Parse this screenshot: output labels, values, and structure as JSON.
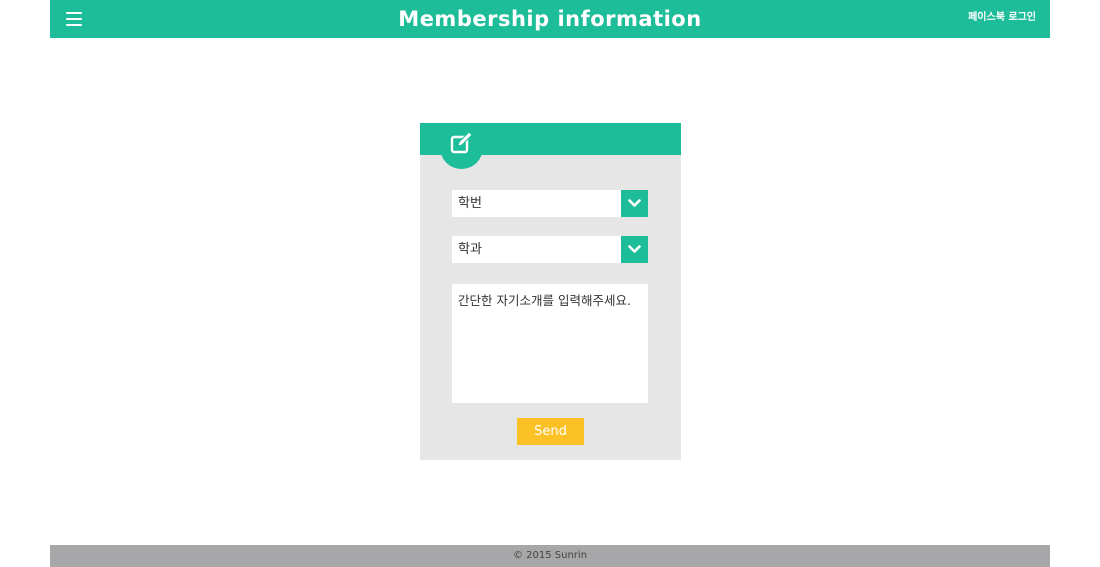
{
  "header": {
    "title": "Membership information",
    "facebook_login": "페이스북 로그인",
    "menu_icon": "hamburger-menu-icon"
  },
  "form": {
    "edit_icon": "edit-icon",
    "student_id_select": {
      "value": "학번",
      "arrow_icon": "chevron-down-icon"
    },
    "department_select": {
      "value": "학과",
      "arrow_icon": "chevron-down-icon"
    },
    "intro": {
      "placeholder": "간단한 자기소개를 입력해주세요."
    },
    "send_label": "Send"
  },
  "footer": {
    "copyright": "© 2015 Sunrin"
  },
  "colors": {
    "accent": "#1dbd9a",
    "card_background": "#e6e6e6",
    "send_button": "#fbc125",
    "footer": "#a7a6a8"
  }
}
